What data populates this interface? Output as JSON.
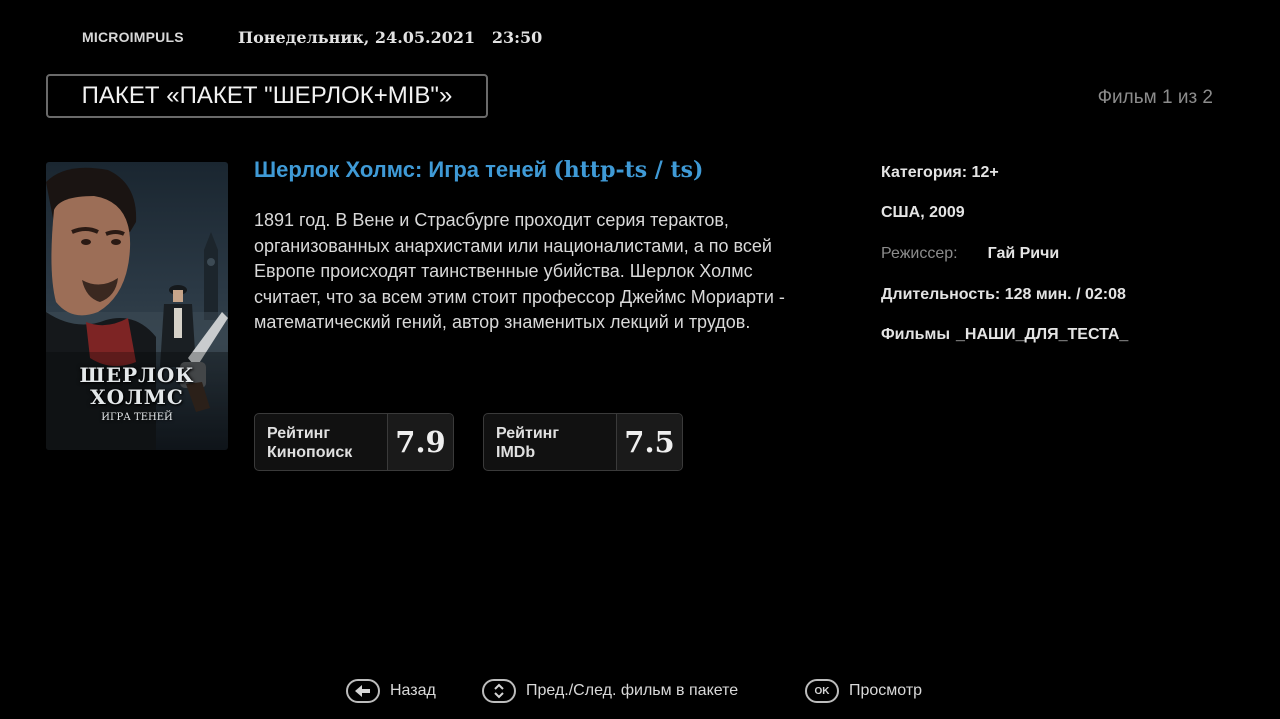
{
  "header": {
    "brand": "MICROIMPULS",
    "datetime": "Понедельник, 24.05.2021   23:50",
    "package_title": "ПАКЕТ «ПАКЕТ \"ШЕРЛОК+MIB\"»",
    "counter": "Фильм 1 из 2"
  },
  "poster": {
    "title_line1": "ШЕРЛОК",
    "title_line2": "ХОЛМС",
    "subtitle": "ИГРА ТЕНЕЙ"
  },
  "film": {
    "title_main": "Шерлок Холмс: Игра теней",
    "title_tech": "(http-ts / ts)",
    "description": "1891 год. В Вене и Страсбурге проходит серия терактов, организованных анархистами или националистами, а по всей Европе происходят таинственные убийства. Шерлок Холмс считает, что за всем этим стоит профессор Джеймс Мориарти - математический гений, автор знаменитых лекций и трудов."
  },
  "ratings": {
    "kinopoisk": {
      "label_line1": "Рейтинг",
      "label_line2": "Кинопоиск",
      "value": "7.9"
    },
    "imdb": {
      "label_line1": "Рейтинг",
      "label_line2": "IMDb",
      "value": "7.5"
    }
  },
  "info": {
    "category": "Категория: 12+",
    "country_year": "США, 2009",
    "director_label": "Режиссер:",
    "director_value": "Гай Ричи",
    "duration": "Длительность: 128 мин. / 02:08",
    "genre_label": "Фильмы",
    "genre_value": "_НАШИ_ДЛЯ_ТЕСТА_"
  },
  "footer": {
    "back_label": "Назад",
    "back_icon": "back-arrow-icon",
    "nav_label": "Пред./След. фильм в пакете",
    "nav_icon": "up-down-icon",
    "ok_key": "OK",
    "play_label": "Просмотр"
  },
  "colors": {
    "background": "#000000",
    "title_accent": "#3f9ad6",
    "muted_text": "#8c8c8c"
  }
}
